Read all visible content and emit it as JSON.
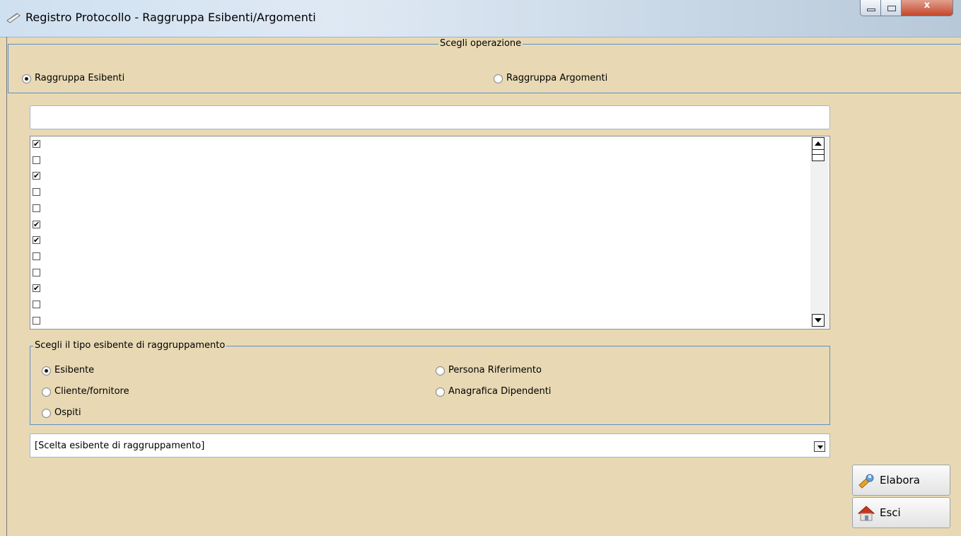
{
  "window": {
    "title": "Registro Protocollo - Raggruppa Esibenti/Argomenti",
    "close_label": "x"
  },
  "operation_group": {
    "legend": "Scegli operazione",
    "options": [
      {
        "label": "Raggruppa Esibenti",
        "selected": true
      },
      {
        "label": "Raggruppa Argomenti",
        "selected": false
      }
    ]
  },
  "search": {
    "value": "",
    "placeholder": ""
  },
  "checklist": {
    "items": [
      {
        "checked": true
      },
      {
        "checked": false
      },
      {
        "checked": true
      },
      {
        "checked": false
      },
      {
        "checked": false
      },
      {
        "checked": true
      },
      {
        "checked": true
      },
      {
        "checked": false
      },
      {
        "checked": false
      },
      {
        "checked": true
      },
      {
        "checked": false
      },
      {
        "checked": false
      }
    ]
  },
  "type_group": {
    "legend": "Scegli il tipo esibente di raggruppamento",
    "options": [
      {
        "label": "Esibente",
        "selected": true
      },
      {
        "label": "Cliente/fornitore",
        "selected": false
      },
      {
        "label": "Ospiti",
        "selected": false
      },
      {
        "label": "Persona Riferimento",
        "selected": false
      },
      {
        "label": "Anagrafica Dipendenti",
        "selected": false
      }
    ]
  },
  "combo": {
    "value": "[Scelta esibente di raggruppamento]"
  },
  "buttons": {
    "elabora": "Elabora",
    "esci": "Esci"
  },
  "colors": {
    "background": "#e8d9b4",
    "group_border": "#5f8fc7"
  },
  "icons": {
    "title": "notepad-icon",
    "elabora": "wrench-icon",
    "esci": "house-exit-icon"
  }
}
